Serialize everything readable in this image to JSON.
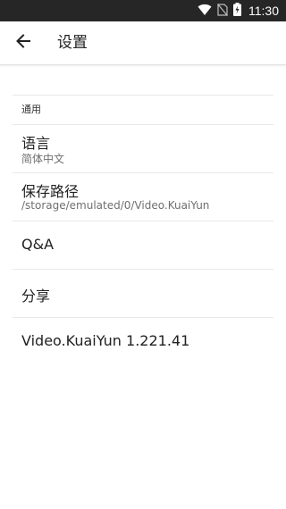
{
  "status_bar": {
    "time": "11:30",
    "icons": [
      "wifi-icon",
      "no-sim-icon",
      "battery-charging-icon"
    ]
  },
  "app_bar": {
    "back_icon": "arrow-left-icon",
    "title": "设置"
  },
  "settings": {
    "section_general": "通用",
    "language": {
      "title": "语言",
      "value": "简体中文"
    },
    "save_path": {
      "title": "保存路径",
      "value": "/storage/emulated/0/Video.KuaiYun"
    },
    "qa": {
      "title": "Q&A"
    },
    "share": {
      "title": "分享"
    },
    "version": {
      "title": "Video.KuaiYun 1.221.41"
    }
  },
  "colors": {
    "status_bar_bg": "#262626",
    "background": "#ffffff",
    "divider": "#e8e8e8",
    "primary_text": "#212121",
    "secondary_text": "#6f6f6f"
  }
}
